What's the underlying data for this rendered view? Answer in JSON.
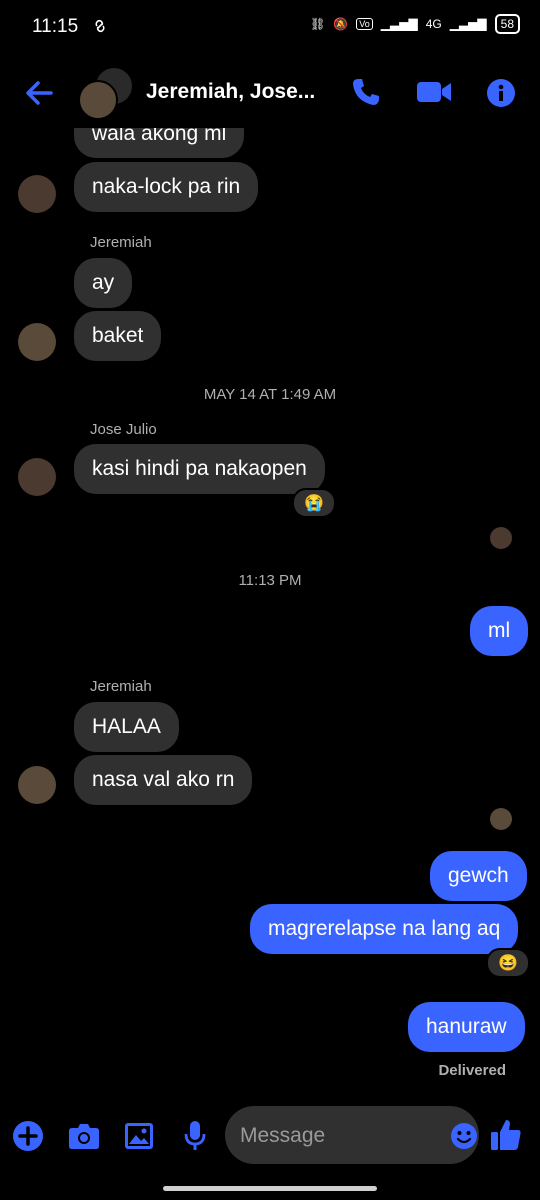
{
  "status_bar": {
    "time": "11:15",
    "network": "4G",
    "battery": "58"
  },
  "header": {
    "title": "Jeremiah, Jose..."
  },
  "messages": {
    "cut_off": "wala akong ml",
    "m1": "naka-lock pa rin",
    "sender_jeremiah_1": "Jeremiah",
    "m2": "ay",
    "m3": "baket",
    "timestamp_1": "MAY 14 AT 1:49 AM",
    "sender_jose": "Jose Julio",
    "m4": "kasi hindi pa nakaopen",
    "reaction_m4": "😭",
    "timestamp_2": "11:13 PM",
    "m5": "ml",
    "sender_jeremiah_2": "Jeremiah",
    "m6": "HALAA",
    "m7": "nasa val ako rn",
    "m8": "gewch",
    "m9": "magrerelapse na lang aq",
    "reaction_m9": "😆",
    "m10": "hanuraw",
    "delivered": "Delivered"
  },
  "composer": {
    "placeholder": "Message"
  },
  "colors": {
    "accent": "#3a64ff",
    "incoming": "#303030",
    "background": "#000000"
  }
}
